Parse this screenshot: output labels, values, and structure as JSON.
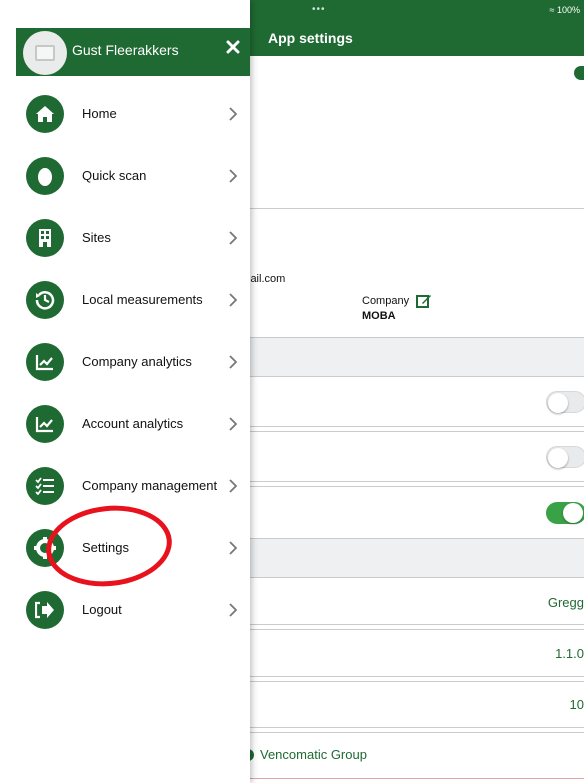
{
  "colors": {
    "brand_green": "#1f6a32",
    "toggle_on": "#3aa246",
    "annotation_red": "#e8121d"
  },
  "drawer": {
    "user_name": "Gust Fleerakkers",
    "avatar_icon": "image-placeholder-icon",
    "close_icon": "close-icon",
    "items": [
      {
        "label": "Home",
        "icon": "home-icon"
      },
      {
        "label": "Quick scan",
        "icon": "drop-icon"
      },
      {
        "label": "Sites",
        "icon": "building-icon"
      },
      {
        "label": "Local measurements",
        "icon": "history-icon"
      },
      {
        "label": "Company analytics",
        "icon": "chart-icon"
      },
      {
        "label": "Account analytics",
        "icon": "chart-icon"
      },
      {
        "label": "Company management",
        "icon": "checklist-icon"
      },
      {
        "label": "Settings",
        "icon": "gear-icon"
      },
      {
        "label": "Logout",
        "icon": "logout-icon"
      }
    ]
  },
  "app": {
    "status_dots": "•••",
    "battery": "100%",
    "title": "App settings",
    "email_fragment": "iail.com",
    "company_label": "Company",
    "company_value": "MOBA",
    "toggles": [
      false,
      false,
      true
    ],
    "values": [
      "Gregg",
      "1.1.0",
      "10"
    ],
    "brand": "Vencomatic Group"
  }
}
